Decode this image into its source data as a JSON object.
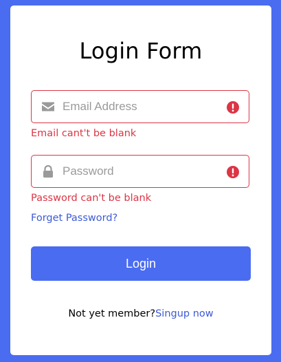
{
  "form": {
    "title": "Login Form",
    "email": {
      "placeholder": "Email Address",
      "value": "",
      "icon": "envelope-icon",
      "error": "Email cant't be blank",
      "status_icon": "exclamation-circle-icon"
    },
    "password": {
      "placeholder": "Password",
      "value": "",
      "icon": "lock-icon",
      "error": "Password can't be blank",
      "status_icon": "exclamation-circle-icon"
    },
    "forgot_label": "Forget Password?",
    "login_label": "Login",
    "signup_prompt": "Not yet member?",
    "signup_link": "Singup now"
  },
  "colors": {
    "background": "#4a6cf0",
    "card": "#ffffff",
    "accent": "#4a6cf0",
    "link": "#3c5ad6",
    "error": "#dc3545",
    "icon_muted": "#9a9a9a"
  }
}
